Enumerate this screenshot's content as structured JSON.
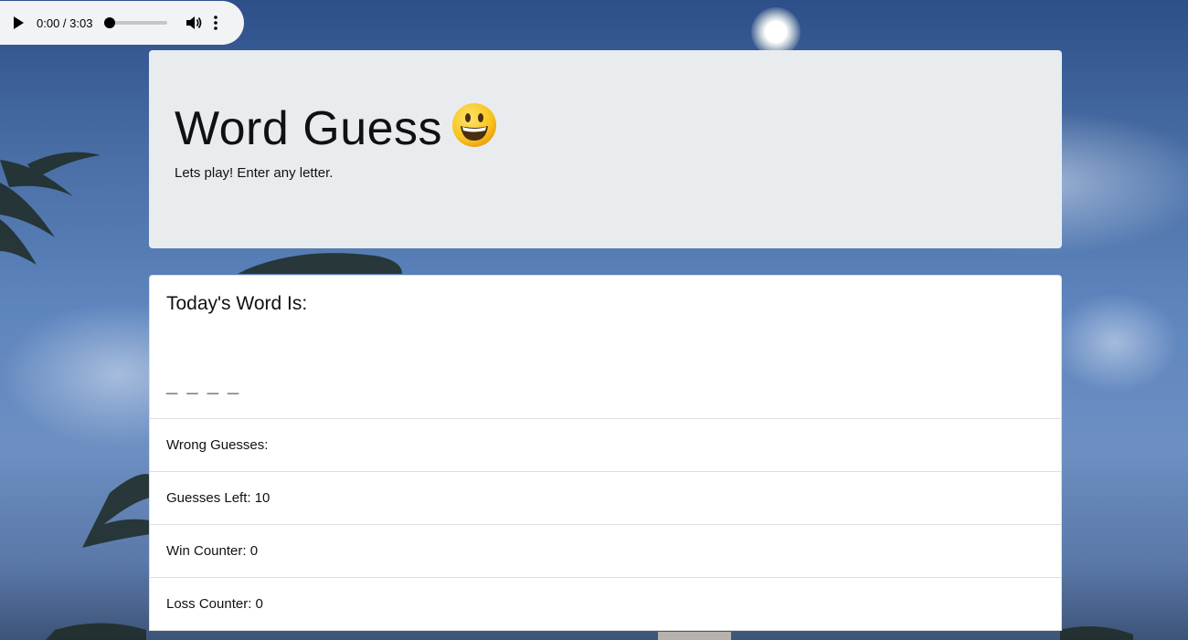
{
  "audio": {
    "time": "0:00 / 3:03"
  },
  "jumbotron": {
    "title": "Word Guess",
    "subtitle": "Lets play! Enter any letter."
  },
  "game": {
    "word_heading": "Today's Word Is:",
    "blanks": "_ _ _ _",
    "wrong_guesses": "Wrong Guesses:",
    "guesses_left": "Guesses Left: 10",
    "win_counter": "Win Counter: 0",
    "loss_counter": "Loss Counter: 0"
  },
  "icons": {
    "play": "play-icon",
    "volume": "volume-icon",
    "more": "more-vertical-icon",
    "emoji": "smiley-emoji-icon"
  }
}
